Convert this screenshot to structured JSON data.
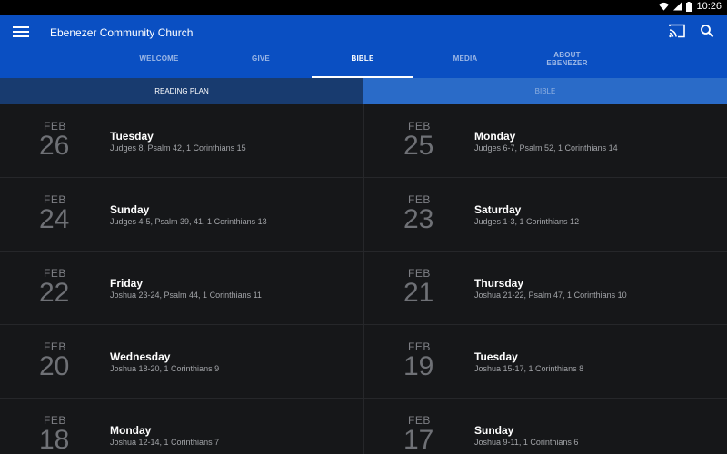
{
  "status_bar": {
    "time": "10:26"
  },
  "app_bar": {
    "title": "Ebenezer Community Church"
  },
  "tabs": [
    {
      "label": "WELCOME"
    },
    {
      "label": "GIVE"
    },
    {
      "label": "BIBLE"
    },
    {
      "label": "MEDIA"
    },
    {
      "label": "ABOUT\nEBENEZER"
    }
  ],
  "subtabs": [
    {
      "label": "READING PLAN"
    },
    {
      "label": "BIBLE"
    }
  ],
  "readings": [
    {
      "month": "FEB",
      "day": "26",
      "weekday": "Tuesday",
      "refs": "Judges 8, Psalm 42, 1 Corinthians 15"
    },
    {
      "month": "FEB",
      "day": "25",
      "weekday": "Monday",
      "refs": "Judges 6-7, Psalm 52, 1 Corinthians 14"
    },
    {
      "month": "FEB",
      "day": "24",
      "weekday": "Sunday",
      "refs": "Judges 4-5, Psalm 39, 41, 1 Corinthians 13"
    },
    {
      "month": "FEB",
      "day": "23",
      "weekday": "Saturday",
      "refs": "Judges 1-3, 1 Corinthians 12"
    },
    {
      "month": "FEB",
      "day": "22",
      "weekday": "Friday",
      "refs": "Joshua 23-24, Psalm 44, 1 Corinthians 11"
    },
    {
      "month": "FEB",
      "day": "21",
      "weekday": "Thursday",
      "refs": "Joshua 21-22, Psalm 47, 1 Corinthians 10"
    },
    {
      "month": "FEB",
      "day": "20",
      "weekday": "Wednesday",
      "refs": "Joshua 18-20, 1 Corinthians 9"
    },
    {
      "month": "FEB",
      "day": "19",
      "weekday": "Tuesday",
      "refs": "Joshua 15-17, 1 Corinthians 8"
    },
    {
      "month": "FEB",
      "day": "18",
      "weekday": "Monday",
      "refs": "Joshua 12-14, 1 Corinthians 7"
    },
    {
      "month": "FEB",
      "day": "17",
      "weekday": "Sunday",
      "refs": "Joshua 9-11, 1 Corinthians 6"
    }
  ]
}
